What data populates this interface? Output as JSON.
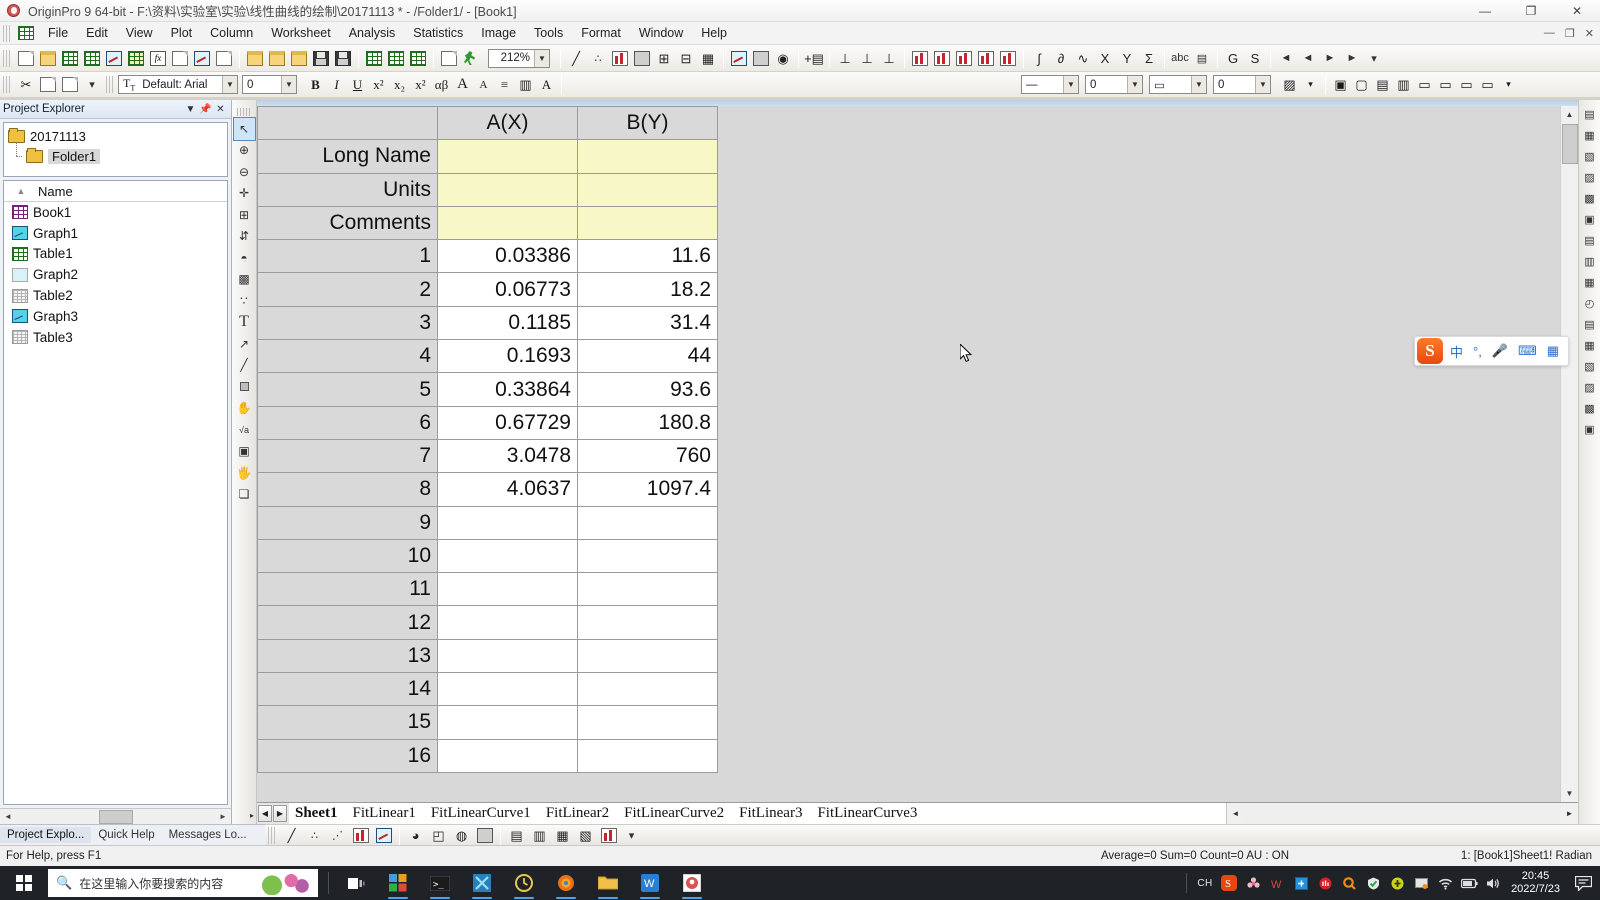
{
  "window": {
    "title": "OriginPro 9 64-bit - F:\\资料\\实验室\\实验\\线性曲线的绘制\\20171113 * - /Folder1/ - [Book1]",
    "app_icon": "origin-icon",
    "minimize": "—",
    "maximize": "❐",
    "close": "✕",
    "doc_minimize": "—",
    "doc_restore": "❐",
    "doc_close": "✕"
  },
  "menubar": {
    "items": [
      "File",
      "Edit",
      "View",
      "Plot",
      "Column",
      "Worksheet",
      "Analysis",
      "Statistics",
      "Image",
      "Tools",
      "Format",
      "Window",
      "Help"
    ]
  },
  "toolbar_standard": {
    "zoom_value": "212%",
    "buttons": [
      "new-project",
      "open-project",
      "new-workbook",
      "new-excel",
      "new-graph",
      "new-matrix",
      "new-function-plot",
      "new-layout",
      "new-notes",
      "append-project",
      "open-template",
      "open-excel",
      "import-wizard",
      "save-project",
      "save-template",
      "import-single-ascii",
      "import-multiple-ascii",
      "import-wizard-2",
      "duplicate",
      "run-script"
    ]
  },
  "toolbar_format": {
    "font_value": "Default: Arial",
    "font_size_value": "0",
    "size_value": "0",
    "bold": "B",
    "italic": "I",
    "underline": "U",
    "superscript": "x²",
    "subscript": "x₂",
    "supersub": "x²",
    "greek": "αβ",
    "increase_font": "A",
    "decrease_font": "A",
    "buttons": [
      "cut",
      "copy",
      "paste",
      "align",
      "pattern",
      "fill-color"
    ]
  },
  "project_explorer": {
    "title": "Project Explorer",
    "dropdown_icon": "chevron-down-icon",
    "pin_icon": "pin-icon",
    "close_icon": "close-icon",
    "tree": [
      {
        "label": "20171113",
        "icon": "folder-icon",
        "selected": false
      },
      {
        "label": "Folder1",
        "icon": "folder-icon",
        "selected": true
      }
    ],
    "list_header": "Name",
    "sort_icon": "sort-asc-icon",
    "items": [
      {
        "label": "Book1",
        "icon": "workbook-icon"
      },
      {
        "label": "Graph1",
        "icon": "graph-icon"
      },
      {
        "label": "Table1",
        "icon": "table-icon"
      },
      {
        "label": "Graph2",
        "icon": "graph-dim-icon"
      },
      {
        "label": "Table2",
        "icon": "table-dim-icon"
      },
      {
        "label": "Graph3",
        "icon": "graph-icon"
      },
      {
        "label": "Table3",
        "icon": "table-dim-icon"
      }
    ]
  },
  "tool_palette": {
    "tools": [
      "pointer-tool",
      "zoom-in-tool",
      "zoom-out-tool",
      "data-reader-tool",
      "screen-reader-tool",
      "data-selector-tool",
      "region-select-tool",
      "mask-tool",
      "scatter-tool",
      "text-tool",
      "arrow-tool",
      "line-tool",
      "rectangle-tool",
      "pan-tool",
      "equation-tool",
      "region-plot-tool",
      "hand-tool",
      "layer-tool"
    ],
    "selected": "pointer-tool"
  },
  "worksheet": {
    "columns": [
      "",
      "A(X)",
      "B(Y)"
    ],
    "meta_rows": [
      "Long Name",
      "Units",
      "Comments"
    ],
    "rows": [
      {
        "n": "1",
        "a": "0.03386",
        "b": "11.6"
      },
      {
        "n": "2",
        "a": "0.06773",
        "b": "18.2"
      },
      {
        "n": "3",
        "a": "0.1185",
        "b": "31.4"
      },
      {
        "n": "4",
        "a": "0.1693",
        "b": "44"
      },
      {
        "n": "5",
        "a": "0.33864",
        "b": "93.6"
      },
      {
        "n": "6",
        "a": "0.67729",
        "b": "180.8"
      },
      {
        "n": "7",
        "a": "3.0478",
        "b": "760"
      },
      {
        "n": "8",
        "a": "4.0637",
        "b": "1097.4"
      },
      {
        "n": "9",
        "a": "",
        "b": ""
      },
      {
        "n": "10",
        "a": "",
        "b": ""
      },
      {
        "n": "11",
        "a": "",
        "b": ""
      },
      {
        "n": "12",
        "a": "",
        "b": ""
      },
      {
        "n": "13",
        "a": "",
        "b": ""
      },
      {
        "n": "14",
        "a": "",
        "b": ""
      },
      {
        "n": "15",
        "a": "",
        "b": ""
      },
      {
        "n": "16",
        "a": "",
        "b": ""
      }
    ]
  },
  "sheet_tabs": {
    "prev_icon": "◀",
    "next_icon": "▶",
    "items": [
      {
        "label": "Sheet1",
        "active": true
      },
      {
        "label": "FitLinear1",
        "active": false
      },
      {
        "label": "FitLinearCurve1",
        "active": false
      },
      {
        "label": "FitLinear2",
        "active": false
      },
      {
        "label": "FitLinearCurve2",
        "active": false
      },
      {
        "label": "FitLinear3",
        "active": false
      },
      {
        "label": "FitLinearCurve3",
        "active": false
      }
    ]
  },
  "dock_tabs": [
    {
      "label": "Project Explo...",
      "active": true
    },
    {
      "label": "Quick Help",
      "active": false
    },
    {
      "label": "Messages Lo...",
      "active": false
    }
  ],
  "statusbar": {
    "help": "For Help, press F1",
    "stats": "Average=0 Sum=0 Count=0  AU : ON",
    "context": "1: [Book1]Sheet1!  Radian"
  },
  "graph_toolbar": {
    "buttons": [
      "line-plot",
      "scatter-plot",
      "line-symbol-plot",
      "column-plot",
      "area-plot",
      "pie-plot",
      "3d-plot",
      "contour-plot",
      "image-plot",
      "stack-plot",
      "template-plot",
      "double-y-plot",
      "multi-panel-plot",
      "bar-plot"
    ]
  },
  "right_dock": {
    "buttons": [
      "add-layer",
      "rescale",
      "legend",
      "axis",
      "grid",
      "speed-mode",
      "new-layer",
      "merge-graph",
      "extract-layers",
      "clock-tool",
      "table-tool",
      "data-tool",
      "layout-tool",
      "export-tool"
    ]
  },
  "ime": {
    "logo": "S",
    "mode": "中",
    "punctuation": "°,",
    "mic_icon": "microphone-icon",
    "keyboard_icon": "keyboard-icon",
    "menu_icon": "apps-icon"
  },
  "taskbar": {
    "start_icon": "windows-logo-icon",
    "search_placeholder": "在这里输入你要搜索的内容",
    "search_icon": "search-icon",
    "cortana_icon": "cortana-art-icon",
    "apps": [
      "task-view-icon",
      "store-icon",
      "terminal-icon",
      "xmind-icon",
      "clock-app-icon",
      "firefox-icon",
      "file-explorer-icon",
      "wps-writer-icon",
      "origin-icon"
    ],
    "tray": {
      "lang": "CH",
      "sogou": "S",
      "icons": [
        "flower-icon",
        "wps-cloud-icon",
        "screenshot-icon",
        "netease-icon",
        "search-tray-icon",
        "security-icon",
        "update-icon",
        "display-icon",
        "wifi-icon",
        "battery-icon",
        "volume-icon"
      ]
    },
    "clock": {
      "time": "20:45",
      "date": "2022/7/23"
    },
    "notification_icon": "notification-icon"
  },
  "colors": {
    "meta_yellow": "#f7f7c8",
    "header_gray": "#d9d9d9",
    "accent_blue": "#2d6fd0",
    "taskbar": "#1f2327"
  }
}
